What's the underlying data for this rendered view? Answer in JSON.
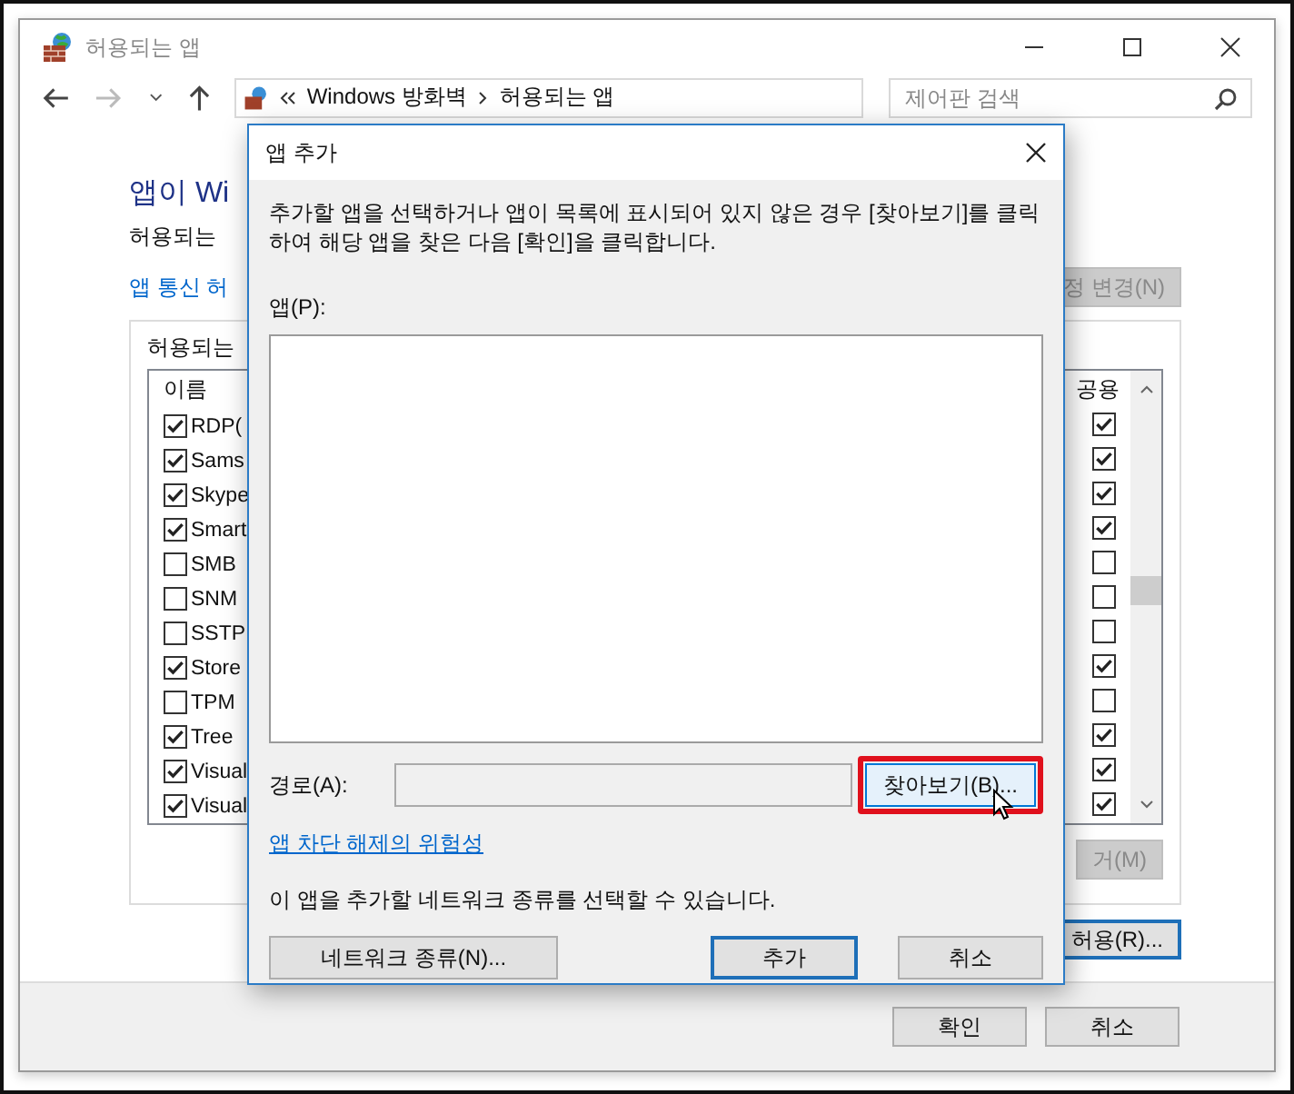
{
  "window": {
    "title": "허용되는 앱"
  },
  "nav": {
    "breadcrumb": [
      "Windows 방화벽",
      "허용되는 앱"
    ],
    "search": {
      "placeholder": "제어판 검색"
    }
  },
  "main": {
    "heading": "앱이 Wi",
    "subtitle": "허용되는",
    "link": "앱 통신 허",
    "change_button": {
      "label": "정 변경(N)",
      "disabled": true
    },
    "group_label": "허용되는",
    "columns": [
      "이름",
      "공용"
    ],
    "rows": [
      {
        "name": "RDP(",
        "checked": true,
        "public": true
      },
      {
        "name": "Sams",
        "checked": true,
        "public": true
      },
      {
        "name": "Skype",
        "checked": true,
        "public": true
      },
      {
        "name": "Smart",
        "checked": true,
        "public": true
      },
      {
        "name": "SMB",
        "checked": false,
        "public": false
      },
      {
        "name": "SNM",
        "checked": false,
        "public": false
      },
      {
        "name": "SSTP",
        "checked": false,
        "public": false
      },
      {
        "name": "Store",
        "checked": true,
        "public": true
      },
      {
        "name": "TPM",
        "checked": false,
        "public": false
      },
      {
        "name": "Tree",
        "checked": true,
        "public": true
      },
      {
        "name": "Visual",
        "checked": true,
        "public": true
      },
      {
        "name": "Visual",
        "checked": true,
        "public": true
      }
    ],
    "remove_button": {
      "label": "거(M)",
      "disabled": true
    },
    "allow_button": {
      "label": "허용(R)...",
      "disabled": false
    }
  },
  "footer": {
    "buttons": [
      "확인",
      "취소"
    ]
  },
  "dialog": {
    "title": "앱 추가",
    "description": "추가할 앱을 선택하거나 앱이 목록에 표시되어 있지 않은 경우 [찾아보기]를 클릭하여 해당 앱을 찾은 다음 [확인]을 클릭합니다.",
    "apps_label": "앱(P):",
    "path_label": "경로(A):",
    "browse_button": {
      "label": "찾아보기(B)...",
      "highlighted": true
    },
    "risk_link": "앱 차단 해제의 위험성",
    "network_note": "이 앱을 추가할 네트워크 종류를 선택할 수 있습니다.",
    "buttons": [
      {
        "label": "네트워크 종류(N)...",
        "default": false
      },
      {
        "label": "추가",
        "default": true
      },
      {
        "label": "취소",
        "default": false
      }
    ]
  }
}
